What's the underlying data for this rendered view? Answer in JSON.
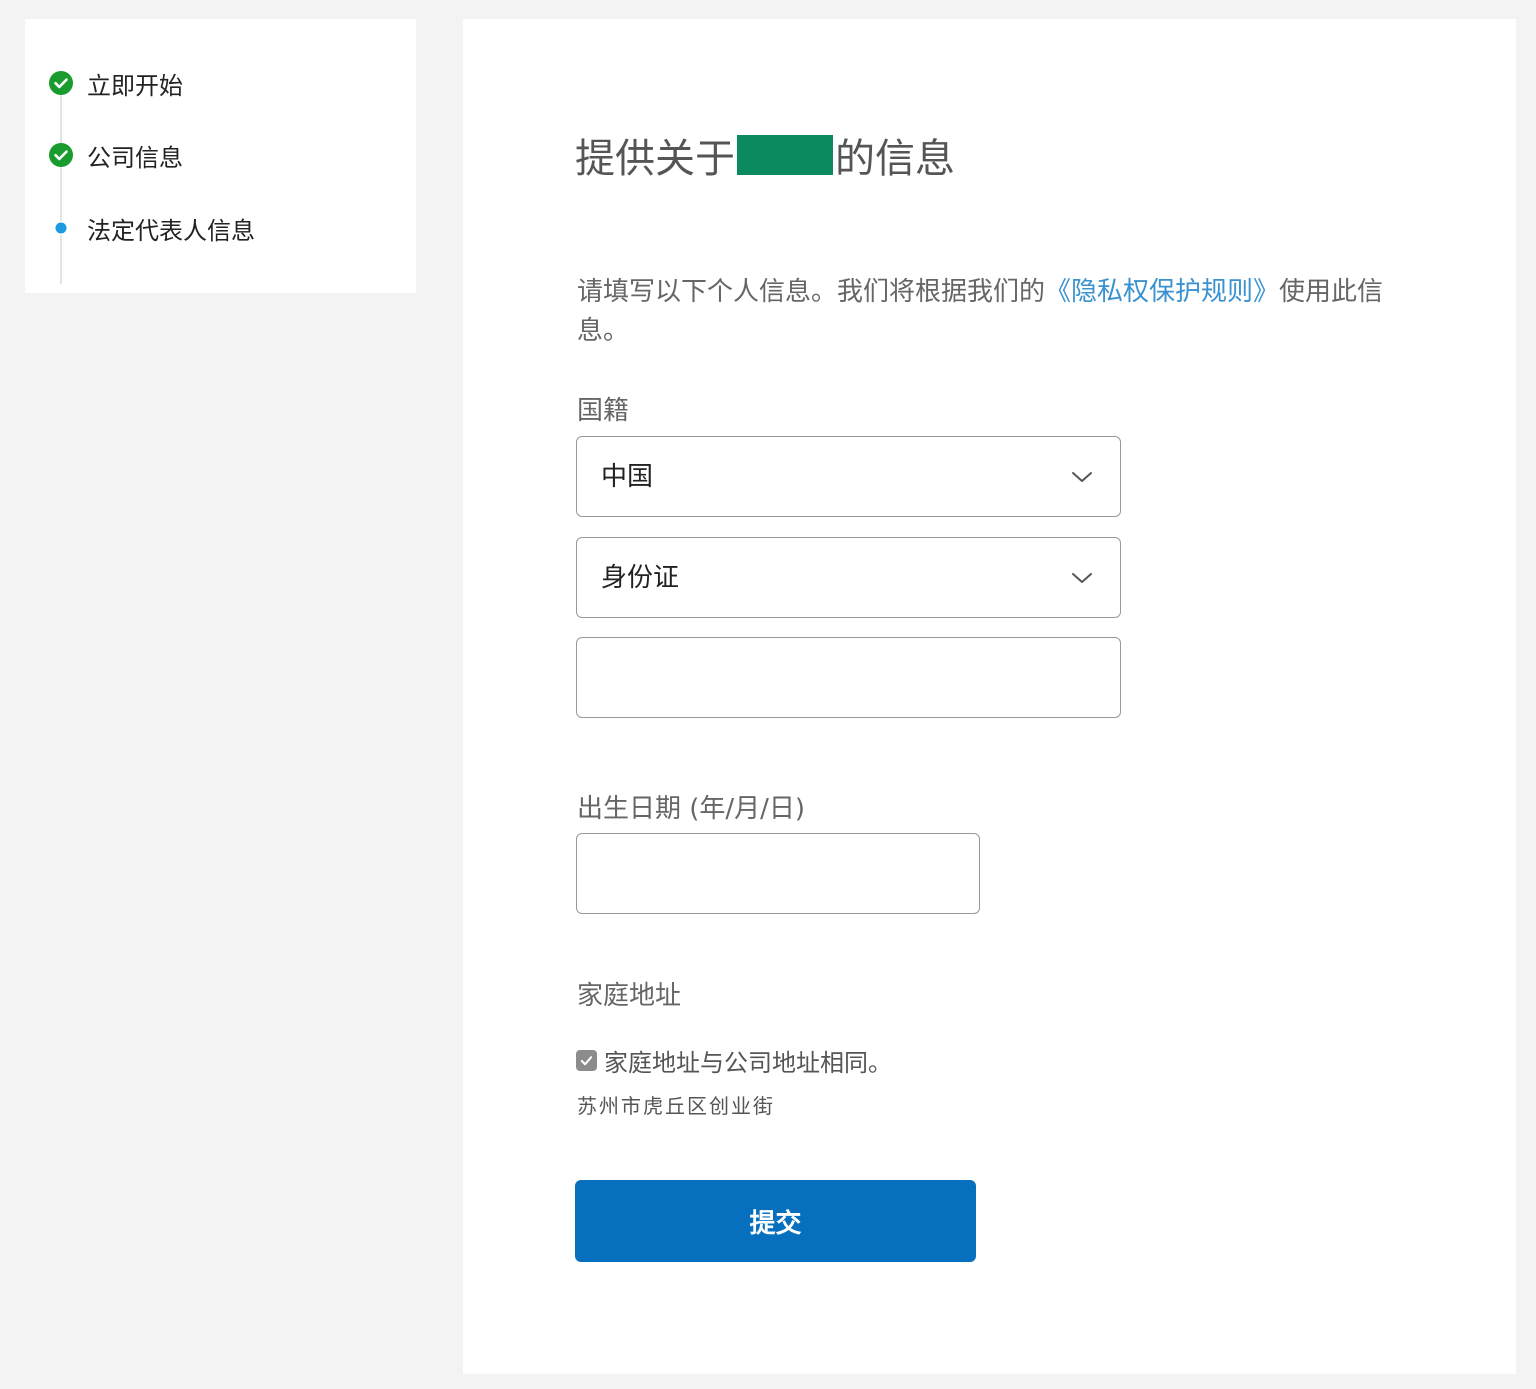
{
  "sidebar": {
    "steps": [
      {
        "label": "立即开始",
        "status": "complete"
      },
      {
        "label": "公司信息",
        "status": "complete"
      },
      {
        "label": "法定代表人信息",
        "status": "current"
      }
    ]
  },
  "form": {
    "heading_prefix": "提供关于",
    "heading_suffix": "的信息",
    "intro_text": "请填写以下个人信息。我们将根据我们的",
    "privacy_link": "《隐私权保护规则》",
    "intro_text_after": "使用此信息。",
    "nationality_label": "国籍",
    "nationality_value": "中国",
    "id_type_value": "身份证",
    "id_number_value": "",
    "dob_label": "出生日期 (年/月/日)",
    "dob_value": "",
    "home_address_label": "家庭地址",
    "same_address_label": "家庭地址与公司地址相同。",
    "same_address_checked": true,
    "company_address": "苏州市虎丘区创业街",
    "submit_label": "提交"
  },
  "colors": {
    "complete_green": "#1a9b2e",
    "current_blue": "#1e9be0",
    "link_blue": "#3a92d0",
    "submit_blue": "#0670be",
    "redaction_green": "#0a8a5e"
  }
}
